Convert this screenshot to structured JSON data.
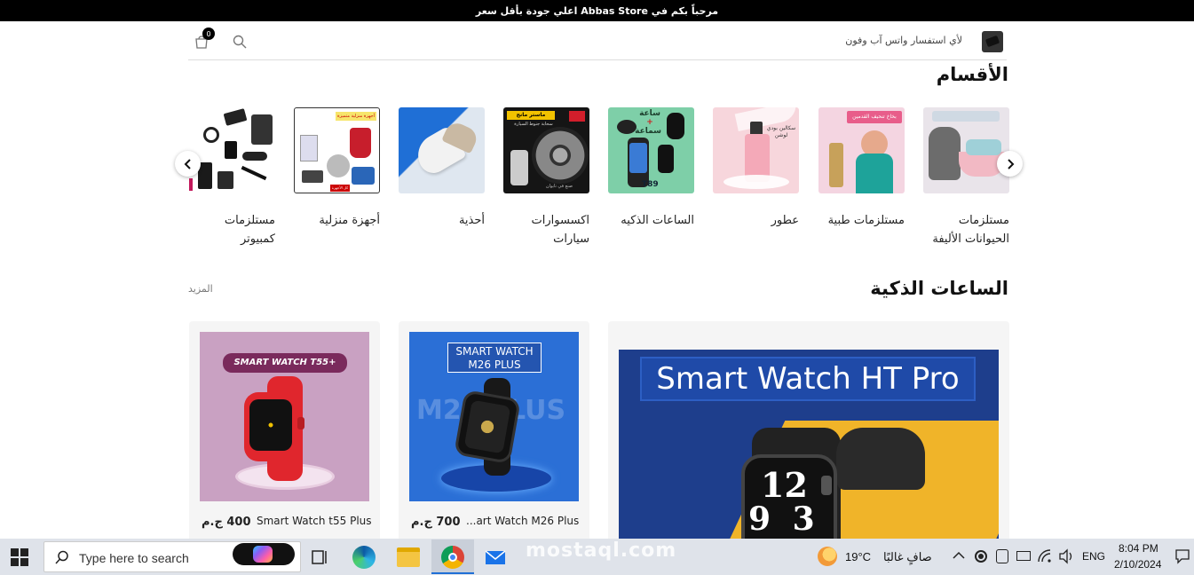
{
  "announcement": "مرحباً بكم في Abbas Store اعلي جودة بأقل سعر",
  "header": {
    "contact": "لأي استفسار واتس آب وفون",
    "cart_count": "0"
  },
  "categories": {
    "title": "الأقسام",
    "items": [
      {
        "label": "مستلزمات الحيوانات الأليفة"
      },
      {
        "label": "مستلزمات طبية"
      },
      {
        "label": "عطور"
      },
      {
        "label": "الساعات الذكيه"
      },
      {
        "label": "اكسسوارات سيارات"
      },
      {
        "label": "أحذية"
      },
      {
        "label": "أجهزة منزلية"
      },
      {
        "label": "مستلزمات كمبيوتر"
      }
    ],
    "images": {
      "medical_banner": "بخاخ تنحيف القدمين",
      "perfume_tag": "سكالين بودي لوشن",
      "watch_line1": "ساعة",
      "watch_line2": "+",
      "watch_line3": "سماعة",
      "watch_model": "T89",
      "car_brand": "ماستر مانج",
      "car_sub": "سحابة جنوط السيارة",
      "car_foot": "صنع في تايوان",
      "home_banner": "أجهزة منزلية متميزة",
      "home_foot": "كل الأجهزة"
    }
  },
  "smart_watches": {
    "title": "الساعات الذكية",
    "more": "المزيد",
    "products": [
      {
        "banner": "Smart Watch HT Pro",
        "face_hour": "12",
        "face_min": "9 3"
      },
      {
        "name": "...art Watch M26 Plus",
        "price": "700 ج.م",
        "banner_line1": "SMART WATCH",
        "banner_line2": "M26 PLUS",
        "bg_text": "M26 PLUS"
      },
      {
        "name": "Smart Watch t55 Plus",
        "price": "400 ج.م",
        "banner": "SMART WATCH T55+"
      }
    ]
  },
  "taskbar": {
    "search_placeholder": "Type here to search",
    "temperature": "19°C",
    "weather": "صافٍ غالبًا",
    "language": "ENG",
    "time": "8:04 PM",
    "date": "2/10/2024"
  },
  "watermark": "mostaql.com",
  "colors": {
    "topbar": "#000000",
    "taskbar": "#dfe3ea",
    "m26_bg": "#2b6fd6",
    "t55_bg": "#c9a1c2",
    "ht_bg": "#f0b429"
  }
}
